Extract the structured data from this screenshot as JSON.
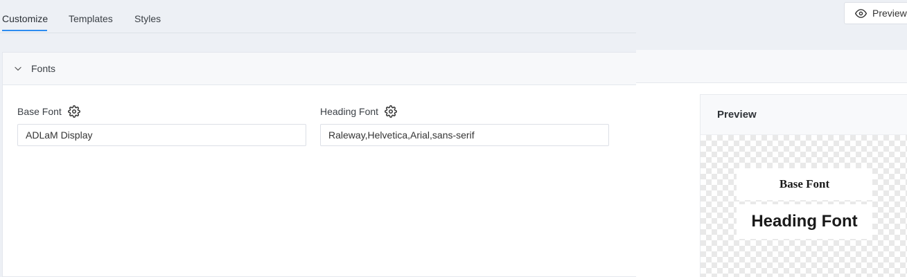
{
  "tabs": [
    {
      "label": "Customize",
      "active": true
    },
    {
      "label": "Templates",
      "active": false
    },
    {
      "label": "Styles",
      "active": false
    }
  ],
  "preview_button": {
    "label": "Preview",
    "icon": "eye-icon"
  },
  "fonts_section": {
    "title": "Fonts",
    "expanded": true,
    "base_font": {
      "label": "Base Font",
      "value": "ADLaM Display",
      "icon": "gear-icon"
    },
    "heading_font": {
      "label": "Heading Font",
      "value": "Raleway,Helvetica,Arial,sans-serif",
      "icon": "gear-icon"
    }
  },
  "preview_panel": {
    "title": "Preview",
    "base_sample": "Base Font",
    "heading_sample": "Heading Font"
  },
  "colors": {
    "accent": "#2d8cf0",
    "background": "#edf0f5"
  }
}
